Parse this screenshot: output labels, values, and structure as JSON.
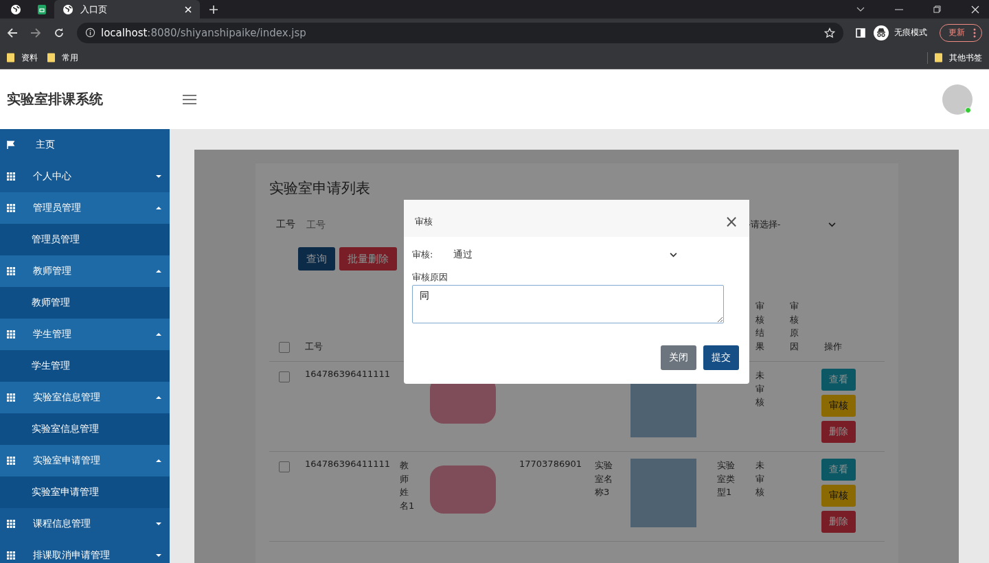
{
  "browser": {
    "tabs": [
      {
        "title": "入口页",
        "selected": true
      }
    ],
    "url_host": "localhost",
    "url_path": ":8080/shiyanshipaike/index.jsp",
    "profile": "无痕模式",
    "update_button": "更新",
    "bookmarks": [
      "资料",
      "常用"
    ],
    "other_bookmarks": "其他书签"
  },
  "header": {
    "title": "实验室排课系统"
  },
  "sidebar": {
    "items": [
      {
        "label": "主页",
        "kind": "home"
      },
      {
        "label": "个人中心",
        "kind": "group",
        "expanded": false
      },
      {
        "label": "管理员管理",
        "kind": "group",
        "expanded": true,
        "children": [
          {
            "label": "管理员管理"
          }
        ]
      },
      {
        "label": "教师管理",
        "kind": "group",
        "expanded": true,
        "children": [
          {
            "label": "教师管理"
          }
        ]
      },
      {
        "label": "学生管理",
        "kind": "group",
        "expanded": true,
        "children": [
          {
            "label": "学生管理"
          }
        ]
      },
      {
        "label": "实验室信息管理",
        "kind": "group",
        "expanded": true,
        "children": [
          {
            "label": "实验室信息管理"
          }
        ]
      },
      {
        "label": "实验室申请管理",
        "kind": "group",
        "expanded": true,
        "children": [
          {
            "label": "实验室申请管理"
          }
        ]
      },
      {
        "label": "课程信息管理",
        "kind": "group",
        "expanded": false
      },
      {
        "label": "排课取消申请管理",
        "kind": "group",
        "expanded": false
      }
    ]
  },
  "page": {
    "title": "实验室申请列表",
    "search_label": "工号",
    "search_placeholder": "工号",
    "select_placeholder": "-请选择-",
    "buttons": [
      {
        "label": "查询",
        "kind": "primary"
      },
      {
        "label": "批量删除",
        "kind": "danger"
      }
    ],
    "table": {
      "columns": [
        {
          "kind": "checkbox",
          "checked": false
        },
        {
          "kind": "text",
          "label": "工号"
        },
        {
          "kind": "covered"
        },
        {
          "kind": "covered"
        },
        {
          "kind": "covered"
        },
        {
          "kind": "covered"
        },
        {
          "kind": "covered"
        },
        {
          "kind": "covered"
        },
        {
          "kind": "stacked",
          "label": "审核结果"
        },
        {
          "kind": "stacked",
          "label": "审核原因"
        },
        {
          "kind": "text",
          "label": "操作"
        }
      ],
      "rows": [
        {
          "selected": false,
          "id": "164786396411111",
          "status": "未审核",
          "actions": [
            {
              "label": "查看",
              "kind": "info"
            },
            {
              "label": "审核",
              "kind": "warning"
            },
            {
              "label": "删除",
              "kind": "danger"
            }
          ]
        },
        {
          "selected": false,
          "id": "164786396411111",
          "teacher": "教师姓名1",
          "phone": "17703786901",
          "lab_name": "实验室名称3",
          "lab_type": "实验室类型1",
          "status": "未审核",
          "actions": [
            {
              "label": "查看",
              "kind": "info"
            },
            {
              "label": "审核",
              "kind": "warning"
            },
            {
              "label": "删除",
              "kind": "danger"
            }
          ]
        }
      ]
    }
  },
  "dialog": {
    "title": "审核",
    "close": "×",
    "fields": [
      {
        "label": "审核:",
        "kind": "select",
        "value": "通过"
      },
      {
        "label": "审核原因",
        "kind": "textarea",
        "value": "同"
      }
    ],
    "buttons": [
      {
        "label": "关闭",
        "kind": "secondary"
      },
      {
        "label": "提交",
        "kind": "primary"
      }
    ]
  }
}
